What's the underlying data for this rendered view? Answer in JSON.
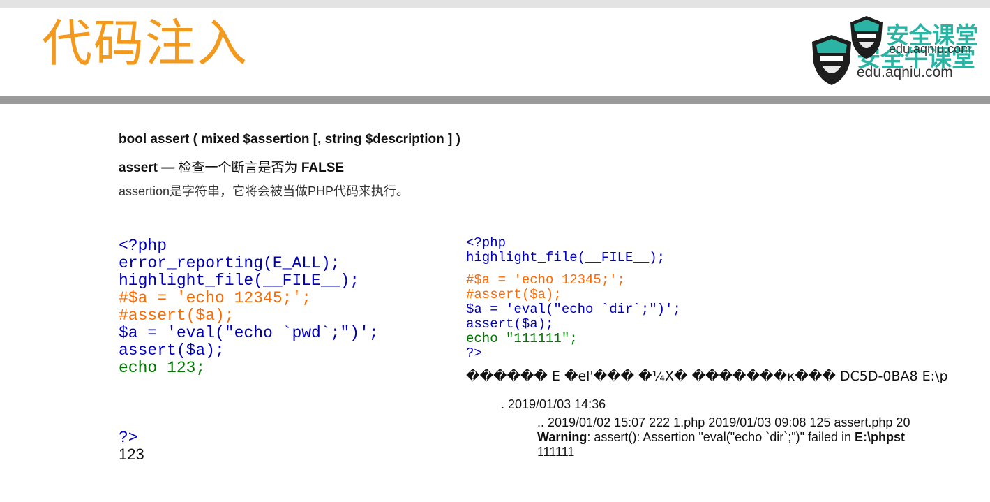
{
  "slide": {
    "title": "代码注入"
  },
  "logo": {
    "brand": "安全牛课堂",
    "url": "edu.aqniu.com",
    "brand_front": "安全课堂",
    "url_front": "edu.aqniu.com",
    "accent": "#2bb3a3"
  },
  "description": {
    "signature": "bool assert ( mixed $assertion [, string $description ] )",
    "summary_code": "assert — ",
    "summary_text": "检查一个断言是否为 ",
    "summary_end": "FALSE",
    "note": "assertion是字符串，它将会被当做PHP代码来执行。"
  },
  "left_code": {
    "lines": [
      {
        "text": "<?php",
        "color": "#0000bb"
      },
      {
        "text": "error_reporting(E_ALL);",
        "color": "#0000bb",
        "punct": "#007700"
      },
      {
        "text": "highlight_file(__FILE__);",
        "color": "#0000bb"
      },
      {
        "text": "#$a = 'echo 12345;';",
        "color": "#ff6a00"
      },
      {
        "text": "#assert($a);",
        "color": "#ff6a00"
      },
      {
        "text": "$a = 'eval(\"echo `pwd`;\")';",
        "color": "#0000bb"
      },
      {
        "text": "assert($a);",
        "color": "#0000bb"
      },
      {
        "text": "echo 123;",
        "color": "#007700"
      }
    ],
    "close_tag": "?>",
    "output": "123"
  },
  "right_code": {
    "open_tag": "<?php",
    "line2": "highlight_file(__FILE__);",
    "line3": "#$a = 'echo 12345;';",
    "line4": "#assert($a);",
    "line5": "$a = 'eval(\"echo `dir`;\")';",
    "line6": "assert($a);",
    "line7": "echo \"111111\";",
    "close_tag": "?>",
    "garbled": "������ E �el'��� �¼X� �������к��� DC5D-0BA8 E:\\p",
    "dir1": ". 2019/01/03 14:36",
    "dir2": ".. 2019/01/02 15:07 222 1.php 2019/01/03 09:08 125 assert.php 20",
    "warning_label": "Warning",
    "warning_text": ": assert(): Assertion \"eval(\"echo `dir`;\")\" failed in ",
    "warning_path": "E:\\phpst",
    "output": "111111"
  }
}
